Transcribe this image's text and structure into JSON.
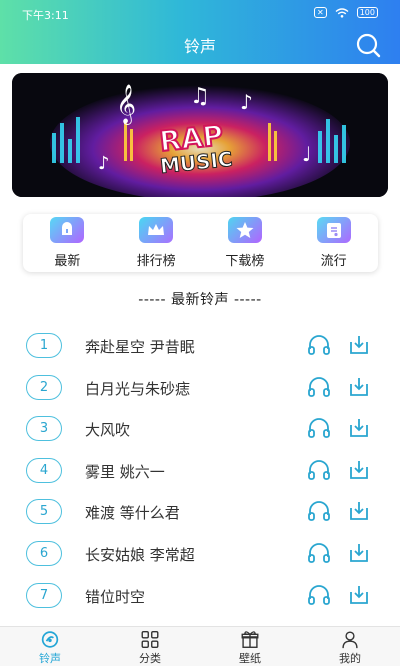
{
  "status_bar": {
    "time": "下午3:11",
    "battery": "100"
  },
  "nav": {
    "title": "铃声"
  },
  "categories": [
    {
      "label": "最新",
      "color_top": "#56d9f5",
      "color_bottom": "#b064ff"
    },
    {
      "label": "排行榜",
      "color_top": "#49d8f2",
      "color_bottom": "#a970ff"
    },
    {
      "label": "下载榜",
      "color_top": "#4fd5f0",
      "color_bottom": "#b263ff"
    },
    {
      "label": "流行",
      "color_top": "#59dbf3",
      "color_bottom": "#ad68ff"
    }
  ],
  "section_title": "----- 最新铃声 -----",
  "songs": [
    {
      "num": "1",
      "title": "奔赴星空 尹昔眠"
    },
    {
      "num": "2",
      "title": "白月光与朱砂痣"
    },
    {
      "num": "3",
      "title": "大风吹"
    },
    {
      "num": "4",
      "title": "雾里 姚六一"
    },
    {
      "num": "5",
      "title": "难渡 等什么君"
    },
    {
      "num": "6",
      "title": "长安姑娘 李常超"
    },
    {
      "num": "7",
      "title": "错位时空"
    }
  ],
  "tabs": [
    {
      "label": "铃声",
      "icon": "ringtone-icon",
      "active": true
    },
    {
      "label": "分类",
      "icon": "grid-icon"
    },
    {
      "label": "壁纸",
      "icon": "gift-icon"
    },
    {
      "label": "我的",
      "icon": "user-icon"
    }
  ],
  "colors": {
    "accent": "#2aa6d0",
    "header_start": "#5ee0a8",
    "header_end": "#2e7ff0"
  }
}
